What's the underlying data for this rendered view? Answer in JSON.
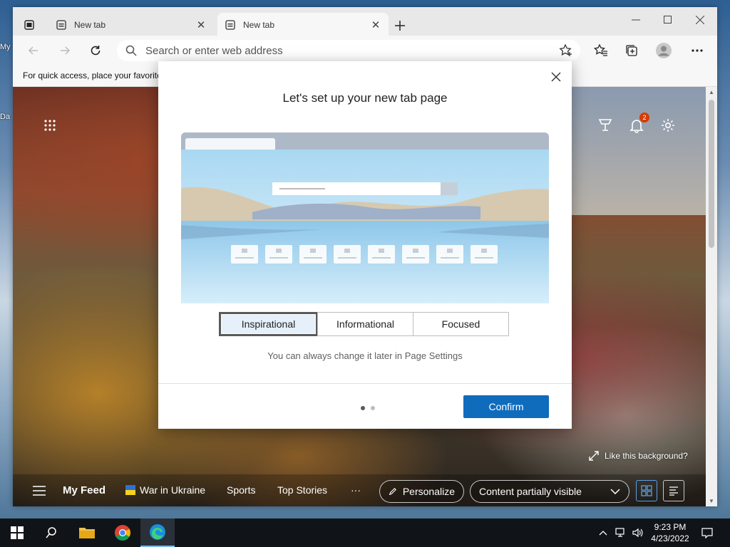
{
  "desktop": {
    "label_my": "My",
    "label_da": "Da"
  },
  "tabs": [
    {
      "title": "New tab",
      "active": false
    },
    {
      "title": "New tab",
      "active": true
    }
  ],
  "toolbar": {
    "address_placeholder": "Search or enter web address"
  },
  "favorites_bar": {
    "text": "For quick access, place your favorites here on the favorites bar."
  },
  "page": {
    "notification_count": "2",
    "like_background": "Like this background?"
  },
  "feed": {
    "my_feed": "My Feed",
    "items": [
      "War in Ukraine",
      "Sports",
      "Top Stories"
    ],
    "more": "···",
    "personalize": "Personalize",
    "content_visibility": "Content partially visible"
  },
  "modal": {
    "title": "Let's set up your new tab page",
    "options": [
      "Inspirational",
      "Informational",
      "Focused"
    ],
    "selected_option": "Inspirational",
    "hint": "You can always change it later in Page Settings",
    "confirm": "Confirm",
    "step": 1,
    "steps": 2
  },
  "taskbar": {
    "time": "9:23 PM",
    "date": "4/23/2022"
  },
  "colors": {
    "accent": "#0f6cbd",
    "badge": "#d83b01"
  }
}
